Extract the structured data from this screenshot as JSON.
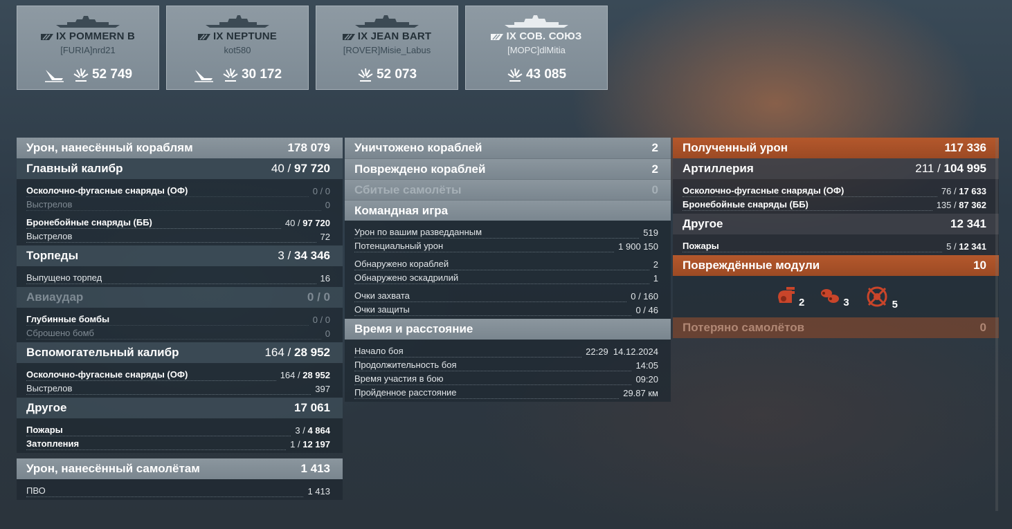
{
  "cards": [
    {
      "ship": "IX POMMERN B",
      "player": "[FURIA]nrd21",
      "damage": "52 749",
      "sunk": true,
      "ally": false
    },
    {
      "ship": "IX NEPTUNE",
      "player": "kot580",
      "damage": "30 172",
      "sunk": true,
      "ally": false
    },
    {
      "ship": "IX JEAN BART",
      "player": "[ROVER]Misie_Labus",
      "damage": "52 073",
      "sunk": false,
      "ally": false
    },
    {
      "ship": "IX СОВ. СОЮЗ",
      "player": "[MOPC]dlMitia",
      "damage": "43 085",
      "sunk": false,
      "ally": true
    }
  ],
  "col1": {
    "ship_damage": {
      "label": "Урон, нанесённый кораблям",
      "value": "178 079"
    },
    "main_battery": {
      "label": "Главный калибр",
      "hits": "40 /",
      "value": "97 720"
    },
    "mb_he": {
      "label": "Осколочно-фугасные снаряды (ОФ)",
      "value": "0 / 0"
    },
    "mb_he_shots": {
      "label": "Выстрелов",
      "value": "0"
    },
    "mb_ap": {
      "label": "Бронебойные снаряды (ББ)",
      "hits": "40 /",
      "value": "97 720"
    },
    "mb_ap_shots": {
      "label": "Выстрелов",
      "value": "72"
    },
    "torpedoes": {
      "label": "Торпеды",
      "hits": "3 /",
      "value": "34 346"
    },
    "torp_launched": {
      "label": "Выпущено торпед",
      "value": "16"
    },
    "airstrike": {
      "label": "Авиаудар",
      "value": "0 / 0"
    },
    "depth_charges": {
      "label": "Глубинные бомбы",
      "value": "0 / 0"
    },
    "bombs_dropped": {
      "label": "Сброшено бомб",
      "value": "0"
    },
    "secondary": {
      "label": "Вспомогательный калибр",
      "hits": "164 /",
      "value": "28 952"
    },
    "sec_he": {
      "label": "Осколочно-фугасные снаряды (ОФ)",
      "hits": "164 /",
      "value": "28 952"
    },
    "sec_shots": {
      "label": "Выстрелов",
      "value": "397"
    },
    "other": {
      "label": "Другое",
      "value": "17 061"
    },
    "fires": {
      "label": "Пожары",
      "hits": "3 /",
      "value": "4 864"
    },
    "floods": {
      "label": "Затопления",
      "hits": "1 /",
      "value": "12 197"
    },
    "plane_damage": {
      "label": "Урон, нанесённый самолётам",
      "value": "1 413"
    },
    "aa": {
      "label": "ПВО",
      "value": "1 413"
    }
  },
  "col2": {
    "destroyed": {
      "label": "Уничтожено кораблей",
      "value": "2"
    },
    "damaged": {
      "label": "Повреждено кораблей",
      "value": "2"
    },
    "planes_shot": {
      "label": "Сбитые самолёты",
      "value": "0"
    },
    "team_play": {
      "label": "Командная игра"
    },
    "spot_damage": {
      "label": "Урон по вашим разведданным",
      "value": "519"
    },
    "potential": {
      "label": "Потенциальный урон",
      "value": "1 900 150"
    },
    "ships_spotted": {
      "label": "Обнаружено кораблей",
      "value": "2"
    },
    "squadrons_spotted": {
      "label": "Обнаружено эскадрилий",
      "value": "1"
    },
    "capture": {
      "label": "Очки захвата",
      "value": "0 / 160"
    },
    "defense": {
      "label": "Очки защиты",
      "value": "0 / 46"
    },
    "time_distance": {
      "label": "Время и расстояние"
    },
    "battle_start": {
      "label": "Начало боя",
      "value": "22:29  14.12.2024"
    },
    "battle_duration": {
      "label": "Продолжительность боя",
      "value": "14:05"
    },
    "time_in_battle": {
      "label": "Время участия в бою",
      "value": "09:20"
    },
    "distance": {
      "label": "Пройденное расстояние",
      "value": "29.87 км"
    }
  },
  "col3": {
    "received": {
      "label": "Полученный урон",
      "value": "117 336"
    },
    "artillery": {
      "label": "Артиллерия",
      "hits": "211 /",
      "value": "104 995"
    },
    "art_he": {
      "label": "Осколочно-фугасные снаряды (ОФ)",
      "hits": "76 /",
      "value": "17 633"
    },
    "art_ap": {
      "label": "Бронебойные снаряды (ББ)",
      "hits": "135 /",
      "value": "87 362"
    },
    "other": {
      "label": "Другое",
      "value": "12 341"
    },
    "fires": {
      "label": "Пожары",
      "hits": "5 /",
      "value": "12 341"
    },
    "modules": {
      "label": "Повреждённые модули",
      "value": "10"
    },
    "module_counts": {
      "turret": "2",
      "torpedo": "3",
      "steering": "5"
    },
    "planes_lost": {
      "label": "Потеряно самолётов",
      "value": "0"
    }
  },
  "colors": {
    "accent_orange": "#b4582c",
    "header_gray": "#8b969e"
  }
}
